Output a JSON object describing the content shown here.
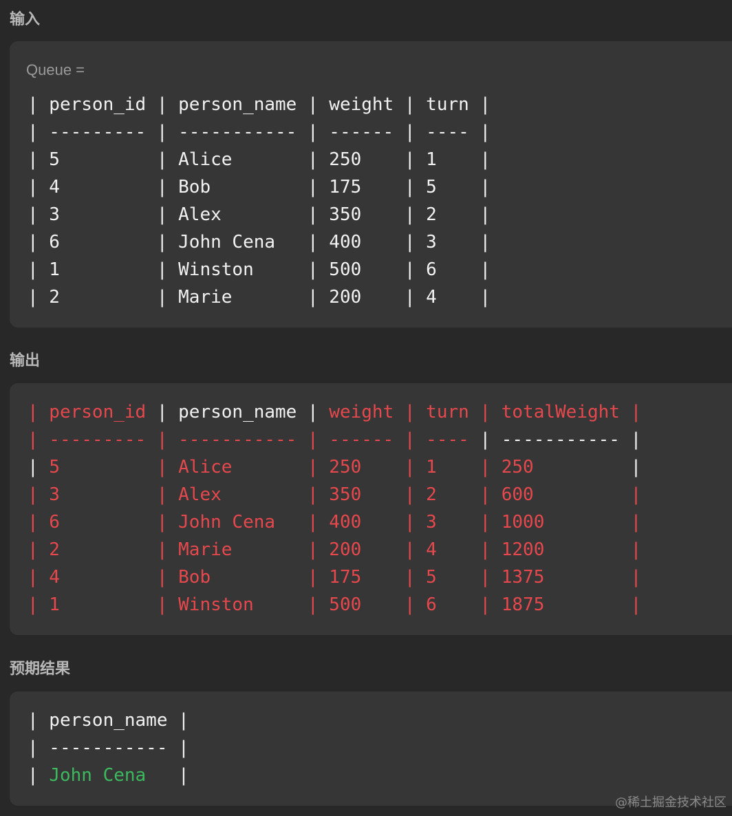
{
  "input_section": {
    "title": "输入",
    "label": "Queue =",
    "rows": [
      {
        "segments": [
          {
            "text": "| person_id | person_name | weight | turn |",
            "color": "#f2f2f2"
          }
        ]
      },
      {
        "segments": [
          {
            "text": "| --------- | ----------- | ------ | ---- |",
            "color": "#f2f2f2"
          }
        ]
      },
      {
        "segments": [
          {
            "text": "| 5         | Alice       | 250    | 1    |",
            "color": "#f2f2f2"
          }
        ]
      },
      {
        "segments": [
          {
            "text": "| 4         | Bob         | 175    | 5    |",
            "color": "#f2f2f2"
          }
        ]
      },
      {
        "segments": [
          {
            "text": "| 3         | Alex        | 350    | 2    |",
            "color": "#f2f2f2"
          }
        ]
      },
      {
        "segments": [
          {
            "text": "| 6         | John Cena   | 400    | 3    |",
            "color": "#f2f2f2"
          }
        ]
      },
      {
        "segments": [
          {
            "text": "| 1         | Winston     | 500    | 6    |",
            "color": "#f2f2f2"
          }
        ]
      },
      {
        "segments": [
          {
            "text": "| 2         | Marie       | 200    | 4    |",
            "color": "#f2f2f2"
          }
        ]
      }
    ]
  },
  "output_section": {
    "title": "输出",
    "rows": [
      {
        "segments": [
          {
            "text": "| person_id ",
            "color": "#e5484d"
          },
          {
            "text": "| person_name | ",
            "color": "#f2f2f2"
          },
          {
            "text": "weight | turn | totalWeight |",
            "color": "#e5484d"
          }
        ]
      },
      {
        "segments": [
          {
            "text": "| --------- | ----------- | ------ | ---- ",
            "color": "#e5484d"
          },
          {
            "text": "| ----------- |",
            "color": "#f2f2f2"
          }
        ]
      },
      {
        "segments": [
          {
            "text": "| ",
            "color": "#f2f2f2"
          },
          {
            "text": "5         | Alice       | 250    | 1    | 250         ",
            "color": "#e5484d"
          },
          {
            "text": "|",
            "color": "#f2f2f2"
          }
        ]
      },
      {
        "segments": [
          {
            "text": "| 3         | Alex        | 350    | 2    | 600         |",
            "color": "#e5484d"
          }
        ]
      },
      {
        "segments": [
          {
            "text": "| 6         | John Cena   | 400    | 3    | 1000        |",
            "color": "#e5484d"
          }
        ]
      },
      {
        "segments": [
          {
            "text": "| 2         | Marie       | 200    | 4    | 1200        |",
            "color": "#e5484d"
          }
        ]
      },
      {
        "segments": [
          {
            "text": "| 4         | Bob         | 175    | 5    | 1375        |",
            "color": "#e5484d"
          }
        ]
      },
      {
        "segments": [
          {
            "text": "| 1         | Winston     | 500    | 6    | 1875        |",
            "color": "#e5484d"
          }
        ]
      }
    ]
  },
  "expected_section": {
    "title": "预期结果",
    "rows": [
      {
        "segments": [
          {
            "text": "| person_name |",
            "color": "#f2f2f2"
          }
        ]
      },
      {
        "segments": [
          {
            "text": "| ----------- |",
            "color": "#f2f2f2"
          }
        ]
      },
      {
        "segments": [
          {
            "text": "| ",
            "color": "#f2f2f2"
          },
          {
            "text": "John Cena   ",
            "color": "#3cb95e"
          },
          {
            "text": "|",
            "color": "#f2f2f2"
          }
        ]
      }
    ]
  },
  "watermark": "@稀土掘金技术社区",
  "colors": {
    "background": "#282828",
    "panel": "#363636",
    "text": "#f2f2f2",
    "diff_red": "#e5484d",
    "match_green": "#3cb95e"
  }
}
